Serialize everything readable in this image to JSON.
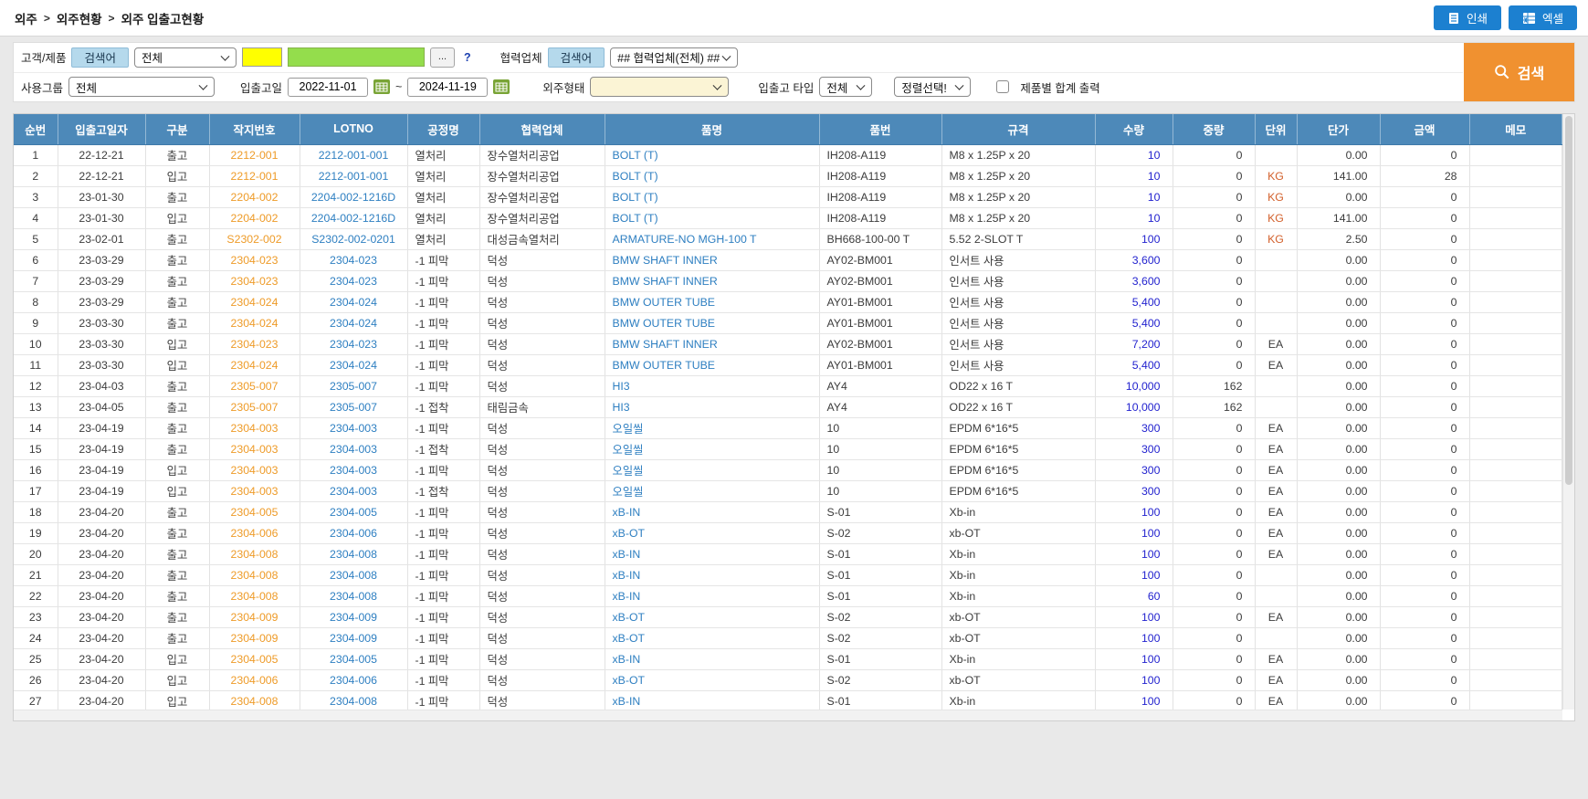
{
  "breadcrumb": {
    "items": [
      "외주",
      "외주현황",
      "외주 입출고현황"
    ],
    "separator": ">"
  },
  "toolbar": {
    "print_label": "인쇄",
    "excel_label": "엑셀"
  },
  "filters": {
    "customer_product_label": "고객/제품",
    "search_term_button": "검색어",
    "scope_select_value": "전체",
    "yellow_input_value": "",
    "green_input_value": "",
    "more_button": "...",
    "help_text": "?",
    "partner_label": "협력업체",
    "partner_search_button": "검색어",
    "partner_select_value": "## 협력업체(전체) ##",
    "usage_group_label": "사용그룹",
    "usage_group_value": "전체",
    "date_label": "입출고일",
    "date_from": "2022-11-01",
    "date_separator": "~",
    "date_to": "2024-11-19",
    "outsourcing_type_label": "외주형태",
    "outsourcing_type_value": "",
    "inout_type_label": "입출고 타입",
    "inout_type_value": "전체",
    "sort_select_value": "정렬선택!",
    "checkbox_label": "제품별 합계 출력",
    "search_button_label": "검색"
  },
  "table": {
    "columns": [
      "순번",
      "입출고일자",
      "구분",
      "작지번호",
      "LOTNO",
      "공정명",
      "협력업체",
      "품명",
      "품번",
      "규격",
      "수량",
      "중량",
      "단위",
      "단가",
      "금액",
      "메모"
    ],
    "rows": [
      [
        "1",
        "22-12-21",
        "출고",
        "2212-001",
        "2212-001-001",
        "열처리",
        "장수열처리공업",
        "BOLT (T)",
        "IH208-A119",
        "M8 x 1.25P x 20",
        "10",
        "0",
        "",
        "0.00",
        "0",
        ""
      ],
      [
        "2",
        "22-12-21",
        "입고",
        "2212-001",
        "2212-001-001",
        "열처리",
        "장수열처리공업",
        "BOLT (T)",
        "IH208-A119",
        "M8 x 1.25P x 20",
        "10",
        "0",
        "KG",
        "141.00",
        "28",
        ""
      ],
      [
        "3",
        "23-01-30",
        "출고",
        "2204-002",
        "2204-002-1216D",
        "열처리",
        "장수열처리공업",
        "BOLT (T)",
        "IH208-A119",
        "M8 x 1.25P x 20",
        "10",
        "0",
        "KG",
        "0.00",
        "0",
        ""
      ],
      [
        "4",
        "23-01-30",
        "입고",
        "2204-002",
        "2204-002-1216D",
        "열처리",
        "장수열처리공업",
        "BOLT (T)",
        "IH208-A119",
        "M8 x 1.25P x 20",
        "10",
        "0",
        "KG",
        "141.00",
        "0",
        ""
      ],
      [
        "5",
        "23-02-01",
        "출고",
        "S2302-002",
        "S2302-002-0201",
        "열처리",
        "대성금속열처리",
        "ARMATURE-NO MGH-100 T",
        "BH668-100-00 T",
        "5.52 2-SLOT T",
        "100",
        "0",
        "KG",
        "2.50",
        "0",
        ""
      ],
      [
        "6",
        "23-03-29",
        "출고",
        "2304-023",
        "2304-023",
        "-1 피막",
        "덕성",
        "BMW SHAFT INNER",
        "AY02-BM001",
        "인서트 사용",
        "3,600",
        "0",
        "",
        "0.00",
        "0",
        ""
      ],
      [
        "7",
        "23-03-29",
        "출고",
        "2304-023",
        "2304-023",
        "-1 피막",
        "덕성",
        "BMW SHAFT INNER",
        "AY02-BM001",
        "인서트 사용",
        "3,600",
        "0",
        "",
        "0.00",
        "0",
        ""
      ],
      [
        "8",
        "23-03-29",
        "출고",
        "2304-024",
        "2304-024",
        "-1 피막",
        "덕성",
        "BMW OUTER TUBE",
        "AY01-BM001",
        "인서트 사용",
        "5,400",
        "0",
        "",
        "0.00",
        "0",
        ""
      ],
      [
        "9",
        "23-03-30",
        "출고",
        "2304-024",
        "2304-024",
        "-1 피막",
        "덕성",
        "BMW OUTER TUBE",
        "AY01-BM001",
        "인서트 사용",
        "5,400",
        "0",
        "",
        "0.00",
        "0",
        ""
      ],
      [
        "10",
        "23-03-30",
        "입고",
        "2304-023",
        "2304-023",
        "-1 피막",
        "덕성",
        "BMW SHAFT INNER",
        "AY02-BM001",
        "인서트 사용",
        "7,200",
        "0",
        "EA",
        "0.00",
        "0",
        ""
      ],
      [
        "11",
        "23-03-30",
        "입고",
        "2304-024",
        "2304-024",
        "-1 피막",
        "덕성",
        "BMW OUTER TUBE",
        "AY01-BM001",
        "인서트 사용",
        "5,400",
        "0",
        "EA",
        "0.00",
        "0",
        ""
      ],
      [
        "12",
        "23-04-03",
        "출고",
        "2305-007",
        "2305-007",
        "-1 피막",
        "덕성",
        "HI3",
        "AY4",
        "OD22 x 16 T",
        "10,000",
        "162",
        "",
        "0.00",
        "0",
        ""
      ],
      [
        "13",
        "23-04-05",
        "출고",
        "2305-007",
        "2305-007",
        "-1 접착",
        "태림금속",
        "HI3",
        "AY4",
        "OD22 x 16 T",
        "10,000",
        "162",
        "",
        "0.00",
        "0",
        ""
      ],
      [
        "14",
        "23-04-19",
        "출고",
        "2304-003",
        "2304-003",
        "-1 피막",
        "덕성",
        "오일씰",
        "10",
        "EPDM 6*16*5",
        "300",
        "0",
        "EA",
        "0.00",
        "0",
        ""
      ],
      [
        "15",
        "23-04-19",
        "출고",
        "2304-003",
        "2304-003",
        "-1 접착",
        "덕성",
        "오일씰",
        "10",
        "EPDM 6*16*5",
        "300",
        "0",
        "EA",
        "0.00",
        "0",
        ""
      ],
      [
        "16",
        "23-04-19",
        "입고",
        "2304-003",
        "2304-003",
        "-1 피막",
        "덕성",
        "오일씰",
        "10",
        "EPDM 6*16*5",
        "300",
        "0",
        "EA",
        "0.00",
        "0",
        ""
      ],
      [
        "17",
        "23-04-19",
        "입고",
        "2304-003",
        "2304-003",
        "-1 접착",
        "덕성",
        "오일씰",
        "10",
        "EPDM 6*16*5",
        "300",
        "0",
        "EA",
        "0.00",
        "0",
        ""
      ],
      [
        "18",
        "23-04-20",
        "출고",
        "2304-005",
        "2304-005",
        "-1 피막",
        "덕성",
        "xB-IN",
        "S-01",
        "Xb-in",
        "100",
        "0",
        "EA",
        "0.00",
        "0",
        ""
      ],
      [
        "19",
        "23-04-20",
        "출고",
        "2304-006",
        "2304-006",
        "-1 피막",
        "덕성",
        "xB-OT",
        "S-02",
        "xb-OT",
        "100",
        "0",
        "EA",
        "0.00",
        "0",
        ""
      ],
      [
        "20",
        "23-04-20",
        "출고",
        "2304-008",
        "2304-008",
        "-1 피막",
        "덕성",
        "xB-IN",
        "S-01",
        "Xb-in",
        "100",
        "0",
        "EA",
        "0.00",
        "0",
        ""
      ],
      [
        "21",
        "23-04-20",
        "출고",
        "2304-008",
        "2304-008",
        "-1 피막",
        "덕성",
        "xB-IN",
        "S-01",
        "Xb-in",
        "100",
        "0",
        "",
        "0.00",
        "0",
        ""
      ],
      [
        "22",
        "23-04-20",
        "출고",
        "2304-008",
        "2304-008",
        "-1 피막",
        "덕성",
        "xB-IN",
        "S-01",
        "Xb-in",
        "60",
        "0",
        "",
        "0.00",
        "0",
        ""
      ],
      [
        "23",
        "23-04-20",
        "출고",
        "2304-009",
        "2304-009",
        "-1 피막",
        "덕성",
        "xB-OT",
        "S-02",
        "xb-OT",
        "100",
        "0",
        "EA",
        "0.00",
        "0",
        ""
      ],
      [
        "24",
        "23-04-20",
        "출고",
        "2304-009",
        "2304-009",
        "-1 피막",
        "덕성",
        "xB-OT",
        "S-02",
        "xb-OT",
        "100",
        "0",
        "",
        "0.00",
        "0",
        ""
      ],
      [
        "25",
        "23-04-20",
        "입고",
        "2304-005",
        "2304-005",
        "-1 피막",
        "덕성",
        "xB-IN",
        "S-01",
        "Xb-in",
        "100",
        "0",
        "EA",
        "0.00",
        "0",
        ""
      ],
      [
        "26",
        "23-04-20",
        "입고",
        "2304-006",
        "2304-006",
        "-1 피막",
        "덕성",
        "xB-OT",
        "S-02",
        "xb-OT",
        "100",
        "0",
        "EA",
        "0.00",
        "0",
        ""
      ],
      [
        "27",
        "23-04-20",
        "입고",
        "2304-008",
        "2304-008",
        "-1 피막",
        "덕성",
        "xB-IN",
        "S-01",
        "Xb-in",
        "100",
        "0",
        "EA",
        "0.00",
        "0",
        ""
      ]
    ]
  },
  "colors": {
    "header_blue": "#4d89b9",
    "button_blue": "#1c80d0",
    "search_orange": "#f09130",
    "link_orange": "#ee9b28",
    "link_blue": "#2e7fc1",
    "qty_blue": "#2323cf",
    "unit_orange": "#d25f2a",
    "highlight_yellow": "#ffff00",
    "highlight_green": "#94dd4c"
  }
}
